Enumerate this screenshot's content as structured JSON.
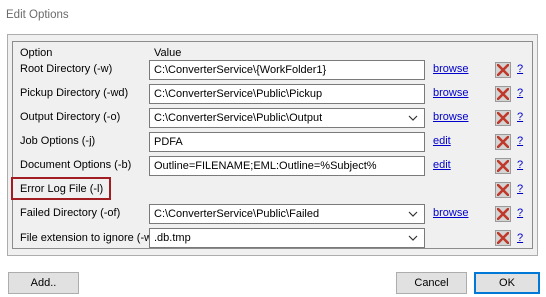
{
  "window": {
    "title": "Edit Options"
  },
  "columns": {
    "option": "Option",
    "value": "Value"
  },
  "rows": [
    {
      "label": "Root Directory (-w)",
      "value": "C:\\ConverterService\\{WorkFolder1}",
      "type": "text",
      "link": "browse",
      "help": "?"
    },
    {
      "label": "Pickup Directory (-wd)",
      "value": "C:\\ConverterService\\Public\\Pickup",
      "type": "text",
      "link": "browse",
      "help": "?"
    },
    {
      "label": "Output Directory (-o)",
      "value": "C:\\ConverterService\\Public\\Output",
      "type": "combo",
      "link": "browse",
      "help": "?"
    },
    {
      "label": "Job Options (-j)",
      "value": "PDFA",
      "type": "text",
      "link": "edit",
      "help": "?"
    },
    {
      "label": "Document Options (-b)",
      "value": "Outline=FILENAME;EML:Outline=%Subject%",
      "type": "text",
      "link": "edit",
      "help": "?"
    },
    {
      "label": "Error Log File (-l)",
      "value": "",
      "type": "none",
      "link": "",
      "help": "?"
    },
    {
      "label": "Failed Directory (-of)",
      "value": "C:\\ConverterService\\Public\\Failed",
      "type": "combo",
      "link": "browse",
      "help": "?"
    },
    {
      "label": "File extension to ignore (-wfi)",
      "value": ".db.tmp",
      "type": "combo",
      "link": "",
      "help": "?"
    }
  ],
  "buttons": {
    "add": "Add..",
    "cancel": "Cancel",
    "ok": "OK"
  },
  "icons": {
    "delete": "delete-x-icon",
    "dropdown": "chevron-down-icon"
  },
  "colors": {
    "highlight_border": "#a11d21",
    "delete_x": "#c0392b",
    "link": "#0000cc",
    "ok_border": "#0078d7"
  }
}
